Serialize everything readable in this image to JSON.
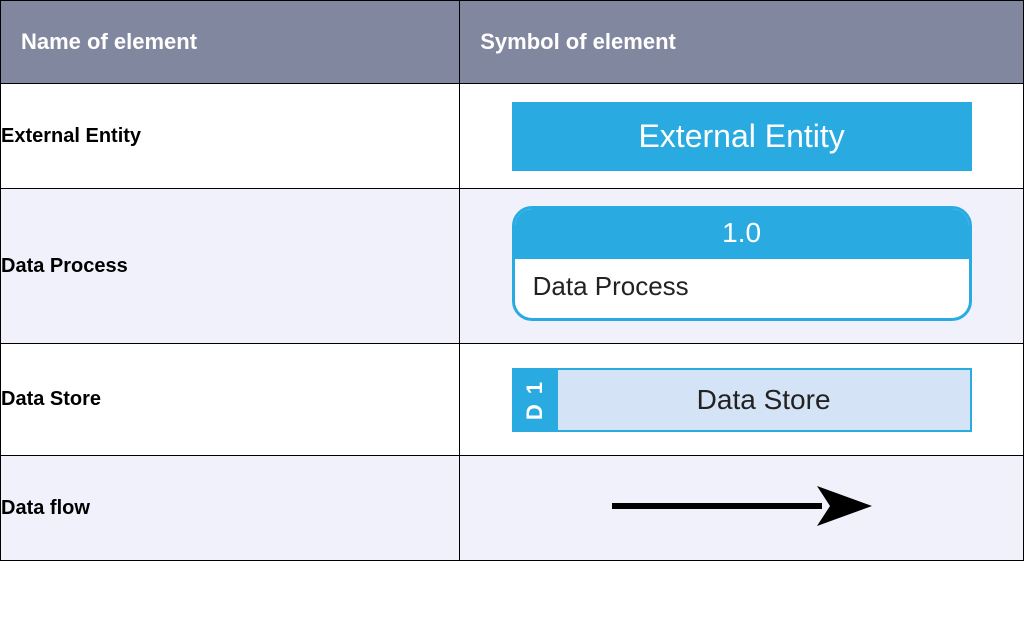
{
  "headers": {
    "name": "Name of element",
    "symbol": "Symbol of element"
  },
  "rows": [
    {
      "name": "External Entity"
    },
    {
      "name": "Data Process"
    },
    {
      "name": "Data Store"
    },
    {
      "name": "Data flow"
    }
  ],
  "symbols": {
    "external_entity": {
      "label": "External Entity"
    },
    "data_process": {
      "number": "1.0",
      "label": "Data Process"
    },
    "data_store": {
      "tab": "D 1",
      "label": "Data Store"
    }
  }
}
